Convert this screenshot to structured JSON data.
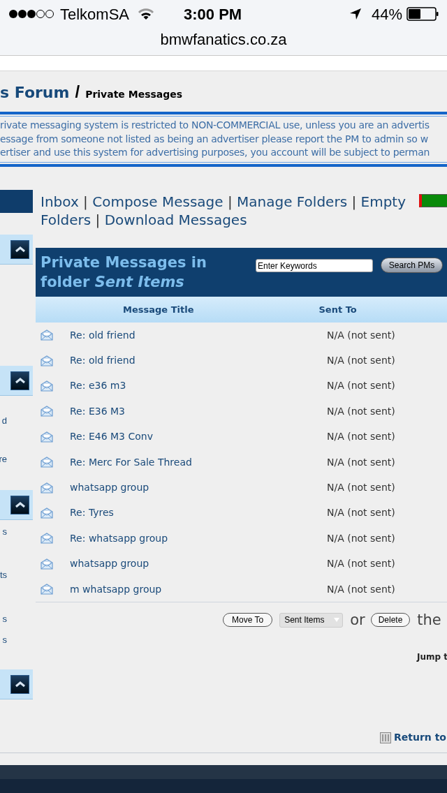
{
  "status_bar": {
    "carrier": "TelkomSA",
    "time": "3:00 PM",
    "battery": "44%"
  },
  "address_bar": {
    "url": "bmwfanatics.co.za"
  },
  "breadcrumb": {
    "forum": "s Forum",
    "separator": "/",
    "current": "Private Messages"
  },
  "notice": [
    "rivate messaging system is restricted to NON-COMMERCIAL use, unless you are an advertis",
    "essage from someone not listed as being an advertiser please report the PM to admin so w",
    "ertiser and use this system for advertising purposes, you account will be subject to perman"
  ],
  "sidebar": {
    "texts": [
      "d",
      "re",
      "s",
      "ts",
      "s",
      "s"
    ]
  },
  "nav_links": [
    {
      "kind": "link",
      "text": "Inbox"
    },
    {
      "kind": "separator",
      "text": "|"
    },
    {
      "kind": "link",
      "text": "Compose Message"
    },
    {
      "kind": "separator",
      "text": "|"
    },
    {
      "kind": "link",
      "text": "Manage Folders"
    },
    {
      "kind": "separator",
      "text": "|"
    },
    {
      "kind": "link",
      "text": "Empty"
    },
    {
      "kind": "link",
      "text": "Folders"
    },
    {
      "kind": "separator",
      "text": "|"
    },
    {
      "kind": "link",
      "text": "Download Messages"
    }
  ],
  "folder_header": {
    "title": "Private Messages in folder *Sent Items*",
    "search_placeholder": "Enter Keywords",
    "search_button": "Search PMs"
  },
  "table": {
    "columns": [
      "Message Title",
      "Sent To"
    ],
    "rows": [
      {
        "title": "Re: old friend",
        "sent_to": "N/A (not sent)"
      },
      {
        "title": "Re: old friend",
        "sent_to": "N/A (not sent)"
      },
      {
        "title": "Re: e36 m3",
        "sent_to": "N/A (not sent)"
      },
      {
        "title": "Re: E36 M3",
        "sent_to": "N/A (not sent)"
      },
      {
        "title": "Re: E46 M3 Conv",
        "sent_to": "N/A (not sent)"
      },
      {
        "title": "Re: Merc For Sale Thread",
        "sent_to": "N/A (not sent)"
      },
      {
        "title": "whatsapp group",
        "sent_to": "N/A (not sent)"
      },
      {
        "title": "Re: Tyres",
        "sent_to": "N/A (not sent)"
      },
      {
        "title": "Re: whatsapp group",
        "sent_to": "N/A (not sent)"
      },
      {
        "title": "whatsapp group",
        "sent_to": "N/A (not sent)"
      },
      {
        "title": "m whatsapp group",
        "sent_to": "N/A (not sent)"
      }
    ]
  },
  "actions": {
    "move_button": "Move To",
    "folder_select": "Sent Items",
    "or": "or",
    "delete_button": "Delete",
    "tail": "the"
  },
  "jump": "Jump t",
  "return_link": "Return to"
}
